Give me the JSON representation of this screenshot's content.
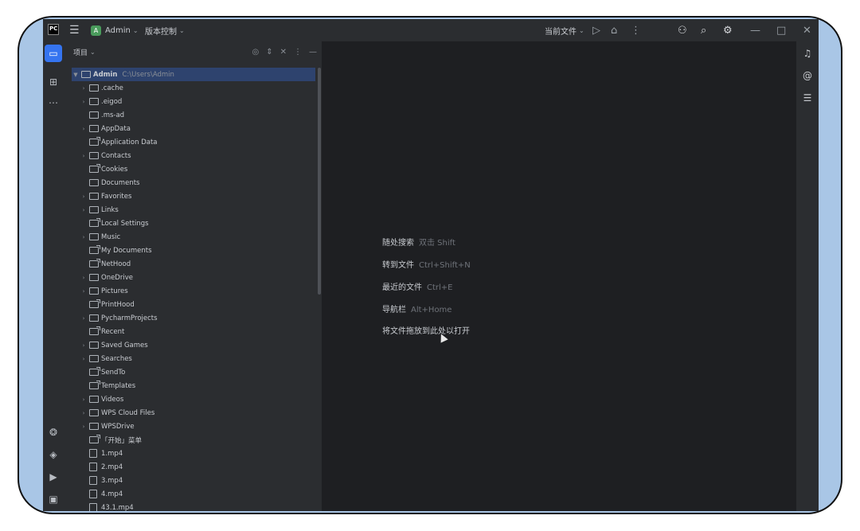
{
  "titlebar": {
    "project_badge_letter": "A",
    "project_name": "Admin",
    "vcs_label": "版本控制",
    "current_file_label": "当前文件"
  },
  "project_panel": {
    "title": "项目"
  },
  "tree": {
    "root": {
      "name": "Admin",
      "path": "C:\\Users\\Admin"
    },
    "items": [
      {
        "name": ".cache",
        "kind": "folder",
        "expandable": true
      },
      {
        "name": ".eigod",
        "kind": "folder",
        "expandable": true
      },
      {
        "name": ".ms-ad",
        "kind": "folder",
        "expandable": false
      },
      {
        "name": "AppData",
        "kind": "folder",
        "expandable": true
      },
      {
        "name": "Application Data",
        "kind": "link",
        "expandable": false
      },
      {
        "name": "Contacts",
        "kind": "folder",
        "expandable": true
      },
      {
        "name": "Cookies",
        "kind": "link",
        "expandable": false
      },
      {
        "name": "Documents",
        "kind": "folder",
        "expandable": false
      },
      {
        "name": "Favorites",
        "kind": "folder",
        "expandable": true
      },
      {
        "name": "Links",
        "kind": "folder",
        "expandable": true
      },
      {
        "name": "Local Settings",
        "kind": "link",
        "expandable": false
      },
      {
        "name": "Music",
        "kind": "folder",
        "expandable": true
      },
      {
        "name": "My Documents",
        "kind": "link",
        "expandable": false
      },
      {
        "name": "NetHood",
        "kind": "link",
        "expandable": false
      },
      {
        "name": "OneDrive",
        "kind": "folder",
        "expandable": true
      },
      {
        "name": "Pictures",
        "kind": "folder",
        "expandable": true
      },
      {
        "name": "PrintHood",
        "kind": "link",
        "expandable": false
      },
      {
        "name": "PycharmProjects",
        "kind": "folder",
        "expandable": true
      },
      {
        "name": "Recent",
        "kind": "link",
        "expandable": false
      },
      {
        "name": "Saved Games",
        "kind": "folder",
        "expandable": true
      },
      {
        "name": "Searches",
        "kind": "folder",
        "expandable": true
      },
      {
        "name": "SendTo",
        "kind": "link",
        "expandable": false
      },
      {
        "name": "Templates",
        "kind": "link",
        "expandable": false
      },
      {
        "name": "Videos",
        "kind": "folder",
        "expandable": true
      },
      {
        "name": "WPS Cloud Files",
        "kind": "folder",
        "expandable": true
      },
      {
        "name": "WPSDrive",
        "kind": "folder",
        "expandable": true
      },
      {
        "name": "「开始」菜单",
        "kind": "link",
        "expandable": false
      },
      {
        "name": "1.mp4",
        "kind": "file",
        "expandable": false
      },
      {
        "name": "2.mp4",
        "kind": "file",
        "expandable": false
      },
      {
        "name": "3.mp4",
        "kind": "file",
        "expandable": false
      },
      {
        "name": "4.mp4",
        "kind": "file",
        "expandable": false
      },
      {
        "name": "43.1.mp4",
        "kind": "file",
        "expandable": false
      }
    ]
  },
  "editor_hints": [
    {
      "label": "随处搜索",
      "shortcut": "双击 Shift"
    },
    {
      "label": "转到文件",
      "shortcut": "Ctrl+Shift+N"
    },
    {
      "label": "最近的文件",
      "shortcut": "Ctrl+E"
    },
    {
      "label": "导航栏",
      "shortcut": "Alt+Home"
    },
    {
      "label": "将文件拖放到此处以打开",
      "shortcut": ""
    }
  ],
  "colors": {
    "accent": "#3574f0",
    "selection": "#2e436e",
    "editor_bg": "#1e1f22",
    "panel_bg": "#2b2d30"
  }
}
